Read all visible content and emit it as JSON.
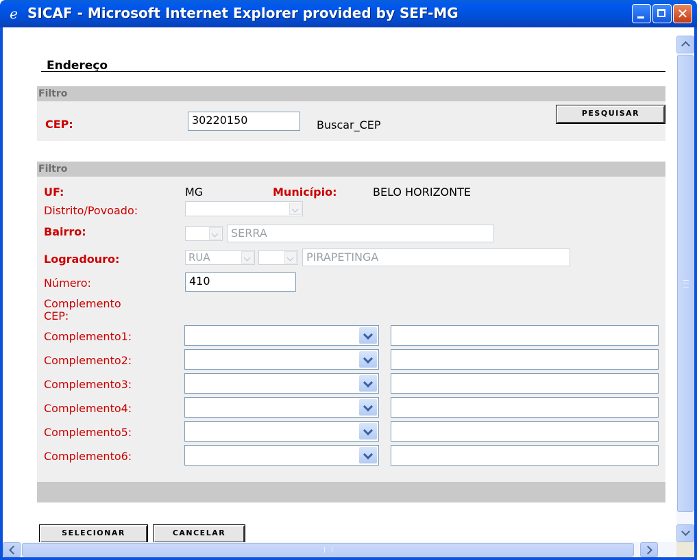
{
  "window": {
    "title": "SICAF - Microsoft Internet Explorer provided by SEF-MG",
    "icon": "ie-icon"
  },
  "page": {
    "title": "Endereço"
  },
  "filtro1": {
    "header": "Filtro",
    "cep_label": "CEP:",
    "cep_value": "30220150",
    "buscar_cep": "Buscar_CEP",
    "pesquisar": "PESQUISAR"
  },
  "filtro2": {
    "header": "Filtro",
    "uf_label": "UF:",
    "uf_value": "MG",
    "municipio_label": "Município:",
    "municipio_value": "BELO HORIZONTE",
    "distrito_label": "Distrito/Povoado:",
    "bairro_label": "Bairro:",
    "bairro_value": "SERRA",
    "logradouro_label": "Logradouro:",
    "logradouro_tipo": "RUA",
    "logradouro_value": "PIRAPETINGA",
    "numero_label": "Número:",
    "numero_value": "410",
    "complemento_cep_label_1": "Complemento",
    "complemento_cep_label_2": "CEP:",
    "complementos": [
      {
        "label": "Complemento1:"
      },
      {
        "label": "Complemento2:"
      },
      {
        "label": "Complemento3:"
      },
      {
        "label": "Complemento4:"
      },
      {
        "label": "Complemento5:"
      },
      {
        "label": "Complemento6:"
      }
    ]
  },
  "actions": {
    "selecionar": "SELECIONAR",
    "cancelar": "CANCELAR"
  },
  "colors": {
    "label_red": "#cc0000",
    "section_header": "#c9c9c9",
    "section_body": "#efefef",
    "titlebar_blue": "#0058ee"
  }
}
